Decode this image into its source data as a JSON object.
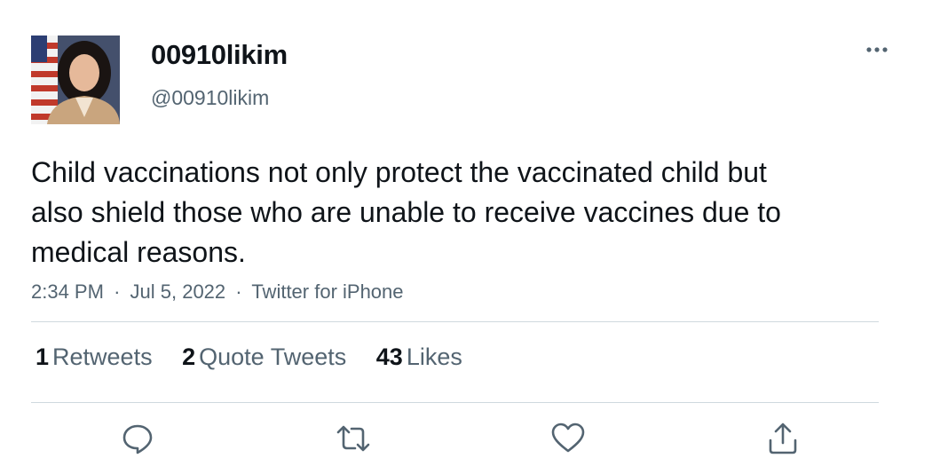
{
  "user": {
    "display_name": "00910likim",
    "handle": "@00910likim",
    "avatar": "profile-photo"
  },
  "tweet": {
    "text": "Child vaccinations not only protect the vaccinated child but also shield those who are unable to receive vaccines due to medical reasons.",
    "time": "2:34 PM",
    "date": "Jul 5, 2022",
    "source": "Twitter for iPhone",
    "separator": "·"
  },
  "stats": {
    "retweets": {
      "count": "1",
      "label": "Retweets"
    },
    "quotes": {
      "count": "2",
      "label": "Quote Tweets"
    },
    "likes": {
      "count": "43",
      "label": "Likes"
    }
  },
  "actions": {
    "reply_icon": "comment-bubble-icon",
    "retweet_icon": "retweet-arrows-icon",
    "like_icon": "heart-icon",
    "share_icon": "share-upload-icon"
  },
  "colors": {
    "text_primary": "#0f1419",
    "text_secondary": "#536471",
    "divider": "#cfd9de",
    "icon": "#536471"
  }
}
